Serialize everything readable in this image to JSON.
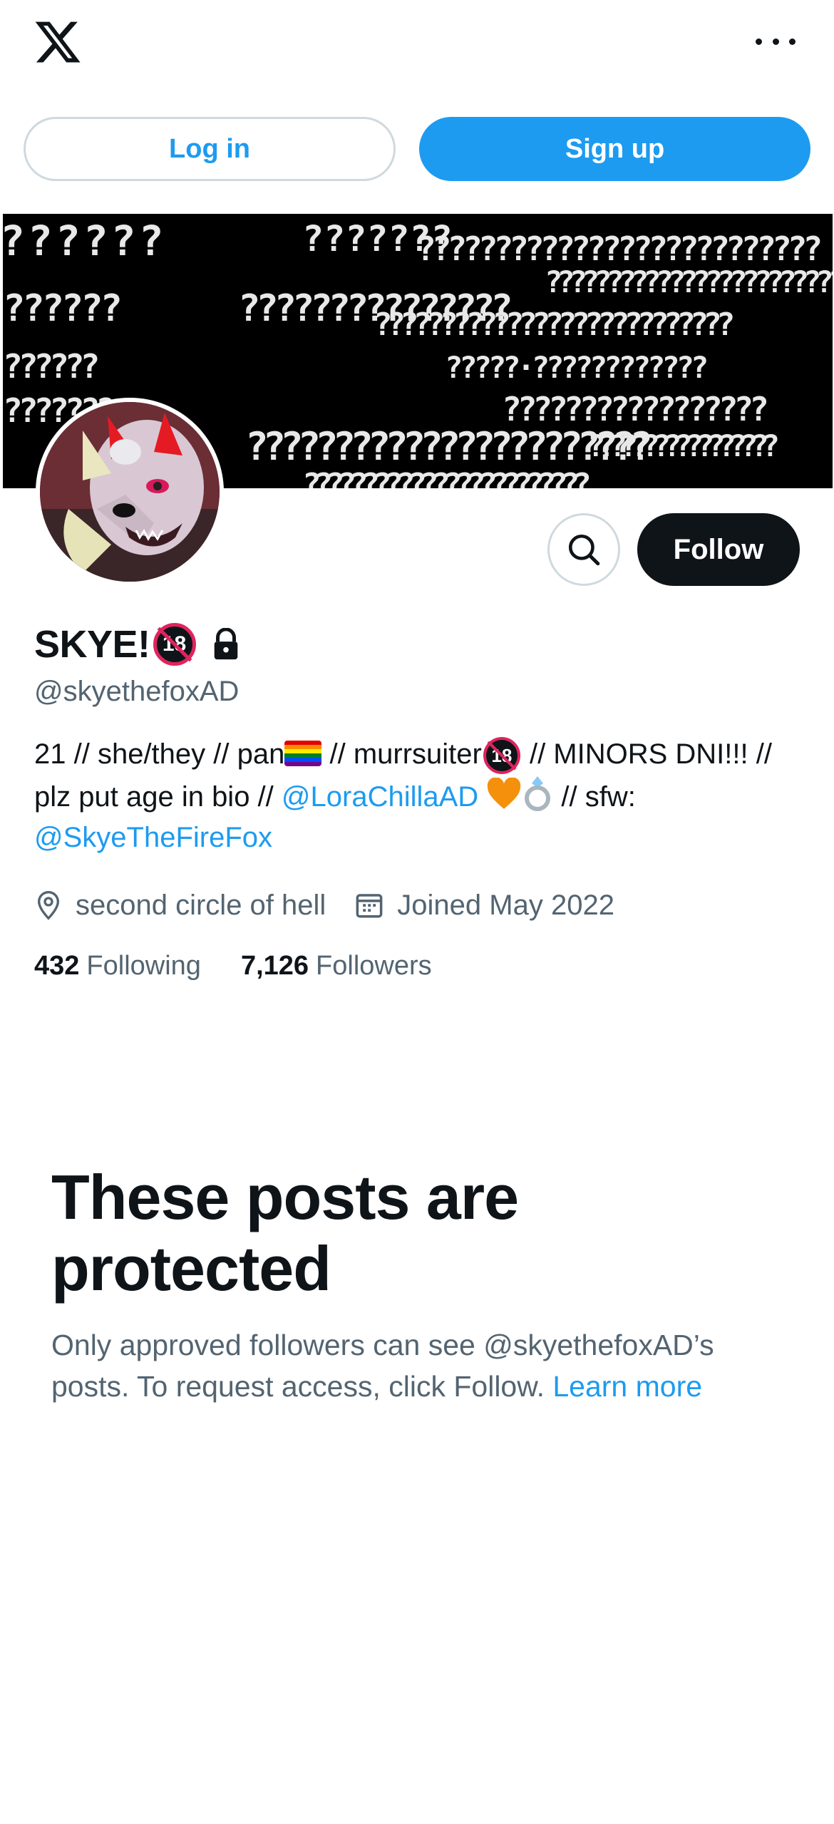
{
  "header": {
    "logo_icon": "x-logo-icon",
    "more_icon": "more-horizontal-icon"
  },
  "auth": {
    "login_label": "Log in",
    "signup_label": "Sign up"
  },
  "profile": {
    "display_name": "SKYE!",
    "name_badge": "18",
    "handle": "@skyethefoxAD",
    "follow_label": "Follow",
    "bio": {
      "part1": "21 // she/they // pan",
      "part2": " // murrsuiter",
      "badge": "18",
      "part3": " // MINORS DNI!!! // plz put age in bio // ",
      "mention1": "@LoraChillaAD",
      "part4": " // sfw: ",
      "mention2": "@SkyeTheFireFox"
    },
    "location": "second circle of hell",
    "joined": "Joined May 2022",
    "following_count": "432",
    "following_label": "Following",
    "followers_count": "7,126",
    "followers_label": "Followers"
  },
  "protected": {
    "title": "These posts are protected",
    "text": "Only approved followers can see @skyethefoxAD’s posts. To request access, click Follow. ",
    "learn_more": "Learn more"
  },
  "colors": {
    "accent": "#1d9bf0",
    "text_primary": "#0f1419",
    "text_secondary": "#536471",
    "border": "#cfd9de",
    "follow_bg": "#0f1419"
  }
}
